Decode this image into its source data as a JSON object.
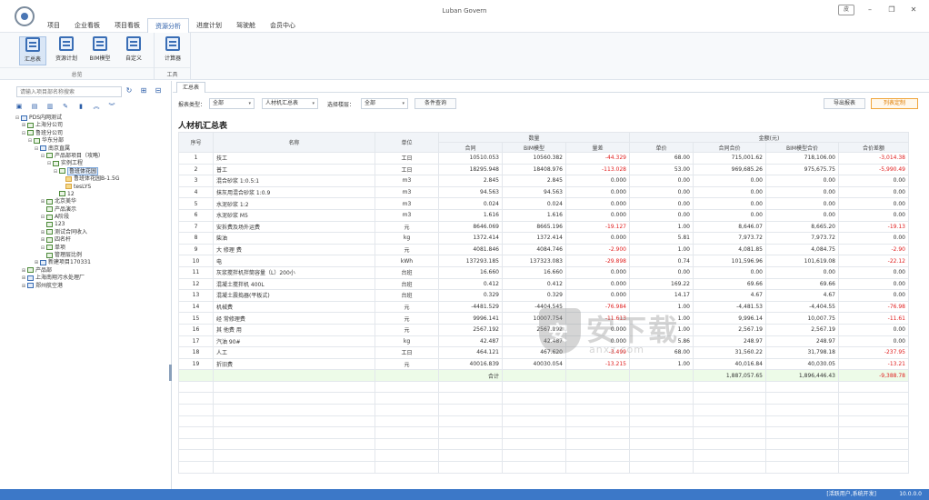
{
  "window": {
    "title": "Luban Govern",
    "skin_label": "皮"
  },
  "menu": [
    {
      "label": "项目",
      "active": false
    },
    {
      "label": "企业看板",
      "active": false
    },
    {
      "label": "项目看板",
      "active": false
    },
    {
      "label": "资源分析",
      "active": true
    },
    {
      "label": "进度计划",
      "active": false
    },
    {
      "label": "驾驶舱",
      "active": false
    },
    {
      "label": "会员中心",
      "active": false
    }
  ],
  "ribbon": {
    "groups": [
      {
        "name": "总览",
        "buttons": [
          "汇总表",
          "资源计划",
          "BIM模型",
          "自定义"
        ]
      },
      {
        "name": "工具",
        "buttons": [
          "计算器"
        ]
      }
    ]
  },
  "left_panel": {
    "search_placeholder": "请输入项目部名称搜索",
    "tree": [
      {
        "label": "PDS内网测试",
        "level": 0,
        "toggle": "⊟",
        "icon": "blue"
      },
      {
        "label": "上海分公司",
        "level": 1,
        "toggle": "⊞",
        "icon": "green"
      },
      {
        "label": "鲁班分公司",
        "level": 1,
        "toggle": "⊟",
        "icon": "green"
      },
      {
        "label": "华东分部",
        "level": 2,
        "toggle": "⊟",
        "icon": "green"
      },
      {
        "label": "南京直属",
        "level": 3,
        "toggle": "⊟",
        "icon": "blue"
      },
      {
        "label": "产品部项目（攻略）",
        "level": 4,
        "toggle": "⊟",
        "icon": "green"
      },
      {
        "label": "实例工程",
        "level": 5,
        "toggle": "⊟",
        "icon": "green"
      },
      {
        "label": "鲁班体花园",
        "level": 6,
        "toggle": "⊟",
        "icon": "green",
        "selected": true
      },
      {
        "label": "鲁班体花园B-1.5G",
        "level": 7,
        "toggle": "",
        "icon": "folder"
      },
      {
        "label": "tesLYS",
        "level": 7,
        "toggle": "",
        "icon": "folder"
      },
      {
        "label": "12",
        "level": 6,
        "toggle": "",
        "icon": "green"
      },
      {
        "label": "北京美华",
        "level": 4,
        "toggle": "⊞",
        "icon": "green"
      },
      {
        "label": "产品演示",
        "level": 4,
        "toggle": "",
        "icon": "green"
      },
      {
        "label": "A阶段",
        "level": 4,
        "toggle": "⊟",
        "icon": "green"
      },
      {
        "label": "123",
        "level": 4,
        "toggle": "",
        "icon": "green"
      },
      {
        "label": "测试合同收入",
        "level": 4,
        "toggle": "⊞",
        "icon": "green"
      },
      {
        "label": "四名杆",
        "level": 4,
        "toggle": "⊞",
        "icon": "green"
      },
      {
        "label": "单项",
        "level": 4,
        "toggle": "⊟",
        "icon": "green"
      },
      {
        "label": "管理层比例",
        "level": 4,
        "toggle": "",
        "icon": "green"
      },
      {
        "label": "新建项目170331",
        "level": 3,
        "toggle": "⊞",
        "icon": "blue"
      },
      {
        "label": "产品部",
        "level": 1,
        "toggle": "⊞",
        "icon": "green"
      },
      {
        "label": "上海南翔污水处理厂",
        "level": 1,
        "toggle": "⊞",
        "icon": "blue"
      },
      {
        "label": "郑州航空港",
        "level": 1,
        "toggle": "⊞",
        "icon": "blue"
      }
    ]
  },
  "content": {
    "tab_label": "汇总表",
    "filters": {
      "type_label": "报表类型：",
      "type_value": "全部",
      "material_value": "人材机汇总表",
      "select_label": "选择楼层：",
      "floor_value": "全部",
      "query_button": "条件查询",
      "export_button": "导出报表",
      "column_button": "列表定制"
    },
    "table_title": "人材机汇总表",
    "group_headers": {
      "qty": "数量",
      "amount": "金额(元)"
    },
    "columns": [
      "序号",
      "名称",
      "单位",
      "合同",
      "BIM模型",
      "量差",
      "单价",
      "合同合价",
      "BIM模型合价",
      "合价差额"
    ],
    "rows": [
      {
        "no": "1",
        "name": "技工",
        "unit": "工日",
        "contract": "10510.053",
        "bim": "10560.382",
        "diff": "-44.329",
        "price": "68.00",
        "contract_total": "715,001.62",
        "bim_total": "718,106.00",
        "total_diff": "-3,014.38"
      },
      {
        "no": "2",
        "name": "普工",
        "unit": "工日",
        "contract": "18295.948",
        "bim": "18408.976",
        "diff": "-113.028",
        "price": "53.00",
        "contract_total": "969,685.26",
        "bim_total": "975,675.75",
        "total_diff": "-5,990.49"
      },
      {
        "no": "3",
        "name": "混合砂浆 1:0.5:1",
        "unit": "m3",
        "contract": "2.845",
        "bim": "2.845",
        "diff": "0.000",
        "price": "0.00",
        "contract_total": "0.00",
        "bim_total": "0.00",
        "total_diff": "0.00"
      },
      {
        "no": "4",
        "name": "抹灰用混合砂浆 1:0.9",
        "unit": "m3",
        "contract": "94.563",
        "bim": "94.563",
        "diff": "0.000",
        "price": "0.00",
        "contract_total": "0.00",
        "bim_total": "0.00",
        "total_diff": "0.00"
      },
      {
        "no": "5",
        "name": "水泥砂浆 1:2",
        "unit": "m3",
        "contract": "0.024",
        "bim": "0.024",
        "diff": "0.000",
        "price": "0.00",
        "contract_total": "0.00",
        "bim_total": "0.00",
        "total_diff": "0.00"
      },
      {
        "no": "6",
        "name": "水泥砂浆 M5",
        "unit": "m3",
        "contract": "1.616",
        "bim": "1.616",
        "diff": "0.000",
        "price": "0.00",
        "contract_total": "0.00",
        "bim_total": "0.00",
        "total_diff": "0.00"
      },
      {
        "no": "7",
        "name": "安拆费及场外运费",
        "unit": "元",
        "contract": "8646.069",
        "bim": "8665.196",
        "diff": "-19.127",
        "price": "1.00",
        "contract_total": "8,646.07",
        "bim_total": "8,665.20",
        "total_diff": "-19.13"
      },
      {
        "no": "8",
        "name": "柴油",
        "unit": "kg",
        "contract": "1372.414",
        "bim": "1372.414",
        "diff": "0.000",
        "price": "5.81",
        "contract_total": "7,973.72",
        "bim_total": "7,973.72",
        "total_diff": "0.00"
      },
      {
        "no": "9",
        "name": "大 修理 费",
        "unit": "元",
        "contract": "4081.846",
        "bim": "4084.746",
        "diff": "-2.900",
        "price": "1.00",
        "contract_total": "4,081.85",
        "bim_total": "4,084.75",
        "total_diff": "-2.90"
      },
      {
        "no": "10",
        "name": "电",
        "unit": "kWh",
        "contract": "137293.185",
        "bim": "137323.083",
        "diff": "-29.898",
        "price": "0.74",
        "contract_total": "101,596.96",
        "bim_total": "101,619.08",
        "total_diff": "-22.12"
      },
      {
        "no": "11",
        "name": "灰浆搅拌机拌筒容量（L）200小",
        "unit": "台班",
        "contract": "16.660",
        "bim": "16.660",
        "diff": "0.000",
        "price": "0.00",
        "contract_total": "0.00",
        "bim_total": "0.00",
        "total_diff": "0.00"
      },
      {
        "no": "12",
        "name": "混凝土搅拌机 400L",
        "unit": "台班",
        "contract": "0.412",
        "bim": "0.412",
        "diff": "0.000",
        "price": "169.22",
        "contract_total": "69.66",
        "bim_total": "69.66",
        "total_diff": "0.00"
      },
      {
        "no": "13",
        "name": "混凝土震捣器(平板式)",
        "unit": "台班",
        "contract": "0.329",
        "bim": "0.329",
        "diff": "0.000",
        "price": "14.17",
        "contract_total": "4.67",
        "bim_total": "4.67",
        "total_diff": "0.00"
      },
      {
        "no": "14",
        "name": "机械费",
        "unit": "元",
        "contract": "-4481.529",
        "bim": "-4404.545",
        "diff": "-76.984",
        "price": "1.00",
        "contract_total": "-4,481.53",
        "bim_total": "-4,404.55",
        "total_diff": "-76.98"
      },
      {
        "no": "15",
        "name": "经 常修理费",
        "unit": "元",
        "contract": "9996.141",
        "bim": "10007.754",
        "diff": "-11.613",
        "price": "1.00",
        "contract_total": "9,996.14",
        "bim_total": "10,007.75",
        "total_diff": "-11.61"
      },
      {
        "no": "16",
        "name": "其 他费 用",
        "unit": "元",
        "contract": "2567.192",
        "bim": "2567.192",
        "diff": "0.000",
        "price": "1.00",
        "contract_total": "2,567.19",
        "bim_total": "2,567.19",
        "total_diff": "0.00"
      },
      {
        "no": "17",
        "name": "汽油 90#",
        "unit": "kg",
        "contract": "42.487",
        "bim": "42.487",
        "diff": "0.000",
        "price": "5.86",
        "contract_total": "248.97",
        "bim_total": "248.97",
        "total_diff": "0.00"
      },
      {
        "no": "18",
        "name": "人工",
        "unit": "工日",
        "contract": "464.121",
        "bim": "467.620",
        "diff": "-3.499",
        "price": "68.00",
        "contract_total": "31,560.22",
        "bim_total": "31,798.18",
        "total_diff": "-237.95"
      },
      {
        "no": "19",
        "name": "折旧费",
        "unit": "元",
        "contract": "40016.839",
        "bim": "40030.054",
        "diff": "-13.215",
        "price": "1.00",
        "contract_total": "40,016.84",
        "bim_total": "40,030.05",
        "total_diff": "-13.21"
      }
    ],
    "sum_row": {
      "label": "合计",
      "contract_total": "1,887,057.65",
      "bim_total": "1,896,446.43",
      "total_diff": "-9,388.78"
    }
  },
  "watermark": {
    "text": "安下载",
    "sub": "anxz.com"
  },
  "status": {
    "left": "[活跃用户,系统开发]",
    "version": "10.0.0.0"
  }
}
